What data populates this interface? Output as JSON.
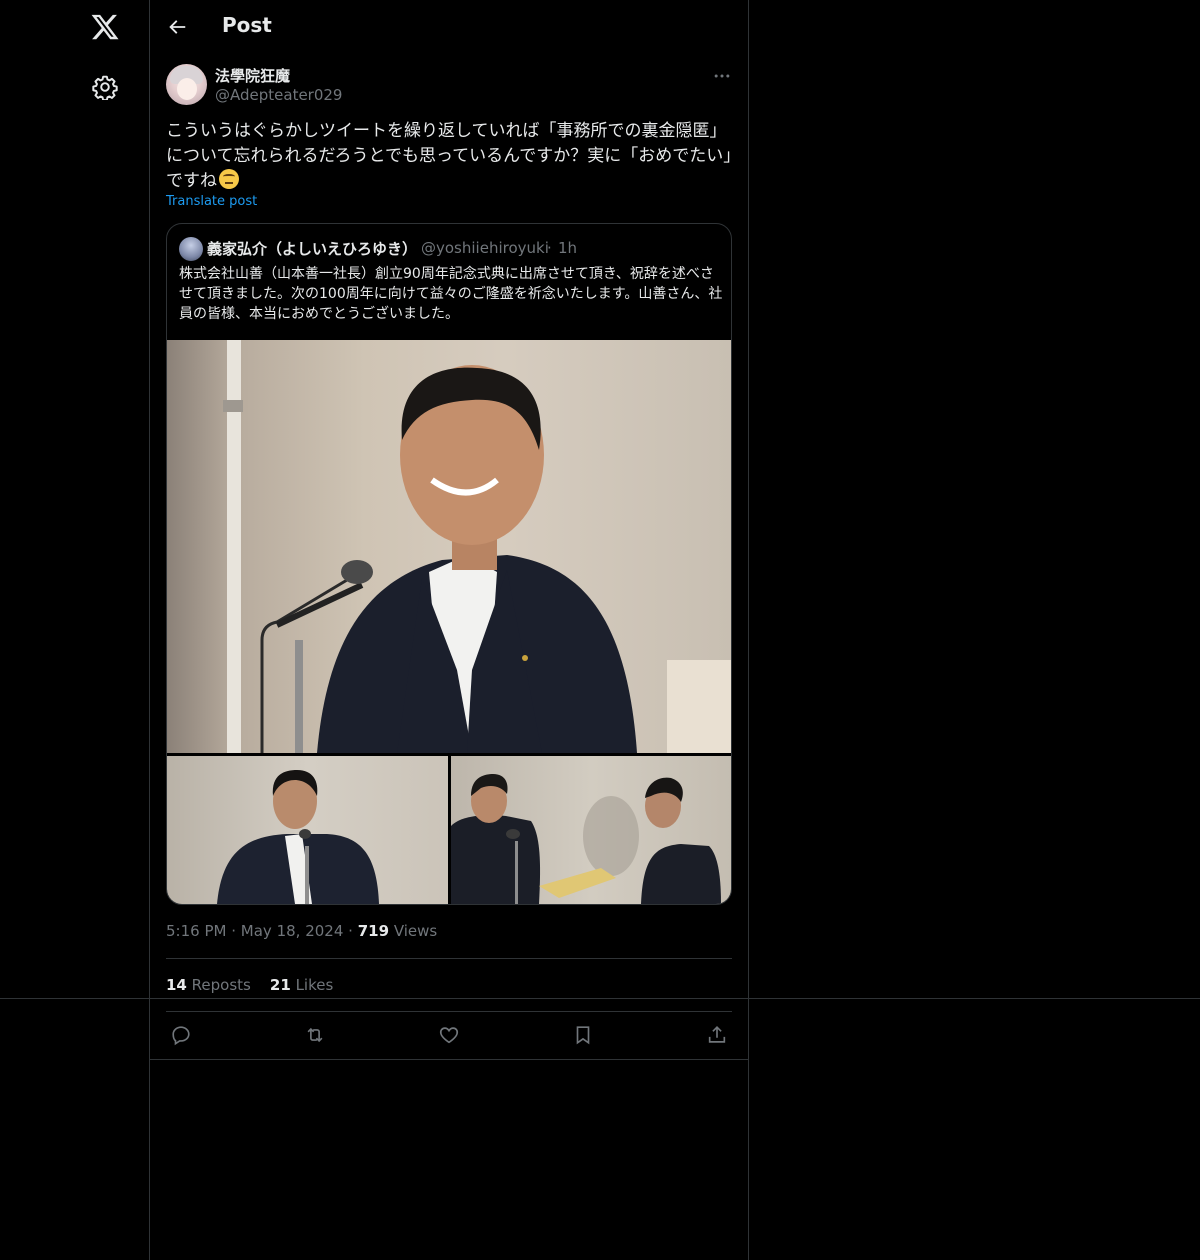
{
  "nav": {
    "logo_icon": "x-logo-icon",
    "settings_icon": "gear-icon"
  },
  "header": {
    "title": "Post",
    "back_icon": "arrow-left-icon"
  },
  "post": {
    "author_name": "法學院狂魔",
    "author_handle": "@Adepteater029",
    "text": "こういうはぐらかしツイートを繰り返していれば「事務所での裏金隠匿」について忘れられるだろうとでも思っているんですか？実に「おめでたい」ですね",
    "emoji": "face-with-rolling-eyes",
    "translate_label": "Translate post",
    "time": "5:16 PM",
    "date": "May 18, 2024",
    "views_count": "719",
    "views_label": "Views",
    "reposts_count": "14",
    "reposts_label": "Reposts",
    "likes_count": "21",
    "likes_label": "Likes"
  },
  "quote": {
    "author_name": "義家弘介（よしいえひろゆき）",
    "author_handle": "@yoshiiehiroyuki",
    "separator": "·",
    "time": "1h",
    "text": "株式会社山善（山本善一社長）創立90周年記念式典に出席させて頂き、祝辞を述べさせて頂きました。次の100周年に向けて益々のご隆盛を祈念いたします。山善さん、社員の皆様、本当におめでとうございました。"
  },
  "meta_sep": "·",
  "actions": [
    "reply-icon",
    "repost-icon",
    "like-icon",
    "bookmark-icon",
    "share-icon"
  ],
  "colors": {
    "background": "#000000",
    "border": "#2f3336",
    "text": "#e7e9ea",
    "muted": "#71767b",
    "link": "#1d9bf0"
  }
}
